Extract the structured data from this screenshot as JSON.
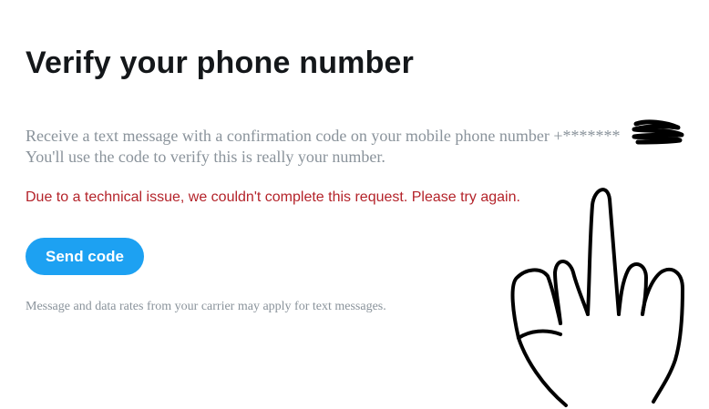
{
  "page": {
    "title": "Verify your phone number",
    "description_line1": "Receive a text message with a confirmation code on your mobile phone number +*******",
    "description_line2": "You'll use the code to verify this is really your number.",
    "error_message": "Due to a technical issue, we couldn't complete this request. Please try again.",
    "send_button_label": "Send code",
    "disclaimer": "Message and data rates from your carrier may apply for text messages."
  },
  "overlays": {
    "redaction_scribble": "black-scribble",
    "hand_drawing": "middle-finger-hand-drawing"
  },
  "colors": {
    "title": "#14171a",
    "body_text": "#8a939b",
    "error": "#b4232a",
    "accent": "#1da1f2",
    "drawing": "#000000"
  }
}
